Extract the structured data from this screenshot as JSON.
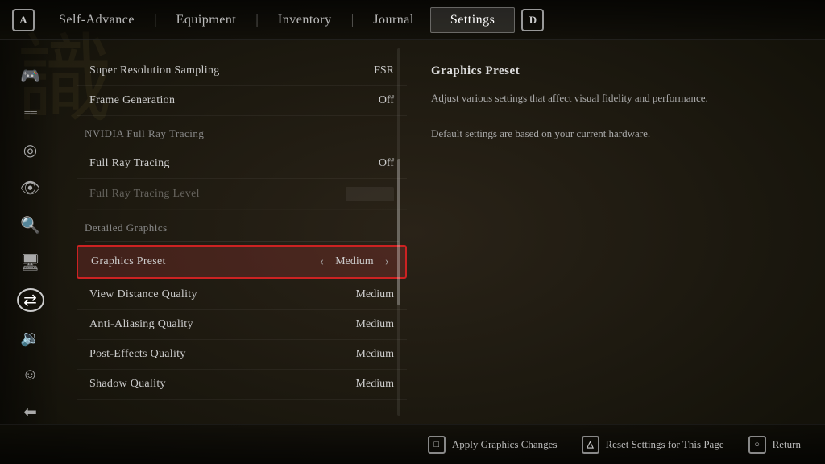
{
  "watermark": "識",
  "nav": {
    "btn_a_label": "A",
    "btn_d_label": "D",
    "items": [
      {
        "label": "Self-Advance",
        "active": false
      },
      {
        "label": "Equipment",
        "active": false
      },
      {
        "label": "Inventory",
        "active": false
      },
      {
        "label": "Journal",
        "active": false
      },
      {
        "label": "Settings",
        "active": true
      }
    ]
  },
  "sidebar": {
    "icons": [
      {
        "name": "controller-icon",
        "glyph": "🎮",
        "active": false
      },
      {
        "name": "settings-sliders-icon",
        "glyph": "≡",
        "active": false
      },
      {
        "name": "target-icon",
        "glyph": "◎",
        "active": false
      },
      {
        "name": "eye-icon",
        "glyph": "👁",
        "active": false
      },
      {
        "name": "search-icon",
        "glyph": "🔍",
        "active": false
      },
      {
        "name": "monitor-icon",
        "glyph": "🖥",
        "active": false
      },
      {
        "name": "adjust-icon",
        "glyph": "⇄",
        "active": true
      },
      {
        "name": "volume-icon",
        "glyph": "🔉",
        "active": false
      },
      {
        "name": "accessibility-icon",
        "glyph": "♿",
        "active": false
      },
      {
        "name": "account-icon",
        "glyph": "⬅",
        "active": false
      }
    ]
  },
  "settings": {
    "rows": [
      {
        "id": "super-resolution",
        "label": "Super Resolution Sampling",
        "value": "FSR",
        "type": "value",
        "section": null,
        "dimmed": false,
        "highlighted": false
      },
      {
        "id": "frame-generation",
        "label": "Frame Generation",
        "value": "Off",
        "type": "value",
        "section": null,
        "dimmed": false,
        "highlighted": false
      },
      {
        "id": "nvidia-header",
        "label": "NVIDIA Full Ray Tracing",
        "value": "",
        "type": "section",
        "dimmed": false,
        "highlighted": false
      },
      {
        "id": "full-ray-tracing",
        "label": "Full Ray Tracing",
        "value": "Off",
        "type": "value",
        "section": null,
        "dimmed": false,
        "highlighted": false
      },
      {
        "id": "full-ray-tracing-level",
        "label": "Full Ray Tracing Level",
        "value": "",
        "type": "value-dimmed",
        "section": null,
        "dimmed": true,
        "highlighted": false
      },
      {
        "id": "detailed-header",
        "label": "Detailed Graphics",
        "value": "",
        "type": "section",
        "dimmed": false,
        "highlighted": false
      },
      {
        "id": "graphics-preset",
        "label": "Graphics Preset",
        "value": "Medium",
        "type": "value-arrows",
        "section": null,
        "dimmed": false,
        "highlighted": true
      },
      {
        "id": "view-distance",
        "label": "View Distance Quality",
        "value": "Medium",
        "type": "value",
        "section": null,
        "dimmed": false,
        "highlighted": false
      },
      {
        "id": "anti-aliasing",
        "label": "Anti-Aliasing Quality",
        "value": "Medium",
        "type": "value",
        "section": null,
        "dimmed": false,
        "highlighted": false
      },
      {
        "id": "post-effects",
        "label": "Post-Effects Quality",
        "value": "Medium",
        "type": "value",
        "section": null,
        "dimmed": false,
        "highlighted": false
      },
      {
        "id": "shadow-quality",
        "label": "Shadow Quality",
        "value": "Medium",
        "type": "value",
        "section": null,
        "dimmed": false,
        "highlighted": false
      }
    ],
    "arrow_left": "‹",
    "arrow_right": "›"
  },
  "description": {
    "title": "Graphics Preset",
    "lines": [
      "Adjust various settings that affect visual fidelity",
      "and performance.",
      "",
      "Default settings are based on your current",
      "hardware."
    ]
  },
  "bottom_bar": {
    "actions": [
      {
        "btn": "□",
        "label": "Apply Graphics Changes"
      },
      {
        "btn": "△",
        "label": "Reset Settings for This Page"
      },
      {
        "btn": "○",
        "label": "Return"
      }
    ]
  }
}
